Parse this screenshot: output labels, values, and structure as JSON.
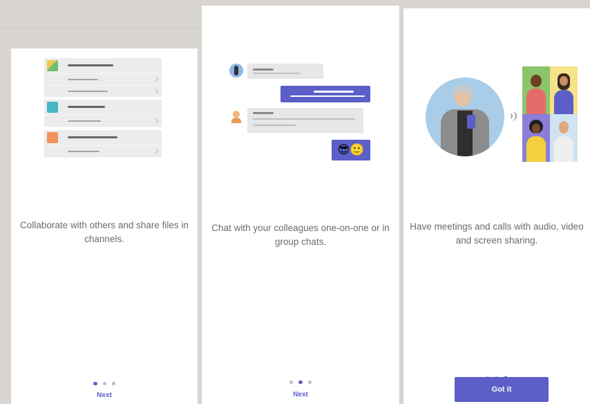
{
  "screens": [
    {
      "caption": "Collaborate with others and share files in channels.",
      "action_label": "Next",
      "page_dots": 3,
      "active_dot": 1
    },
    {
      "caption": "Chat with your colleagues one-on-one or in group chats.",
      "action_label": "Next",
      "page_dots": 3,
      "active_dot": 2,
      "emojis": [
        "😎",
        "🙂"
      ]
    },
    {
      "caption": "Have meetings and calls with audio, video and screen sharing.",
      "action_label": "Got it",
      "page_dots": 3,
      "active_dot": 3
    }
  ],
  "colors": {
    "accent": "#5b5fc7",
    "page_background": "#d9d6d2",
    "panel": "#ffffff",
    "caption_text": "#6b6b6b"
  },
  "icons": [
    "channel-image-icon",
    "channel-teal-icon",
    "channel-orange-icon",
    "person-avatar-icon",
    "sound-wave-icon"
  ]
}
